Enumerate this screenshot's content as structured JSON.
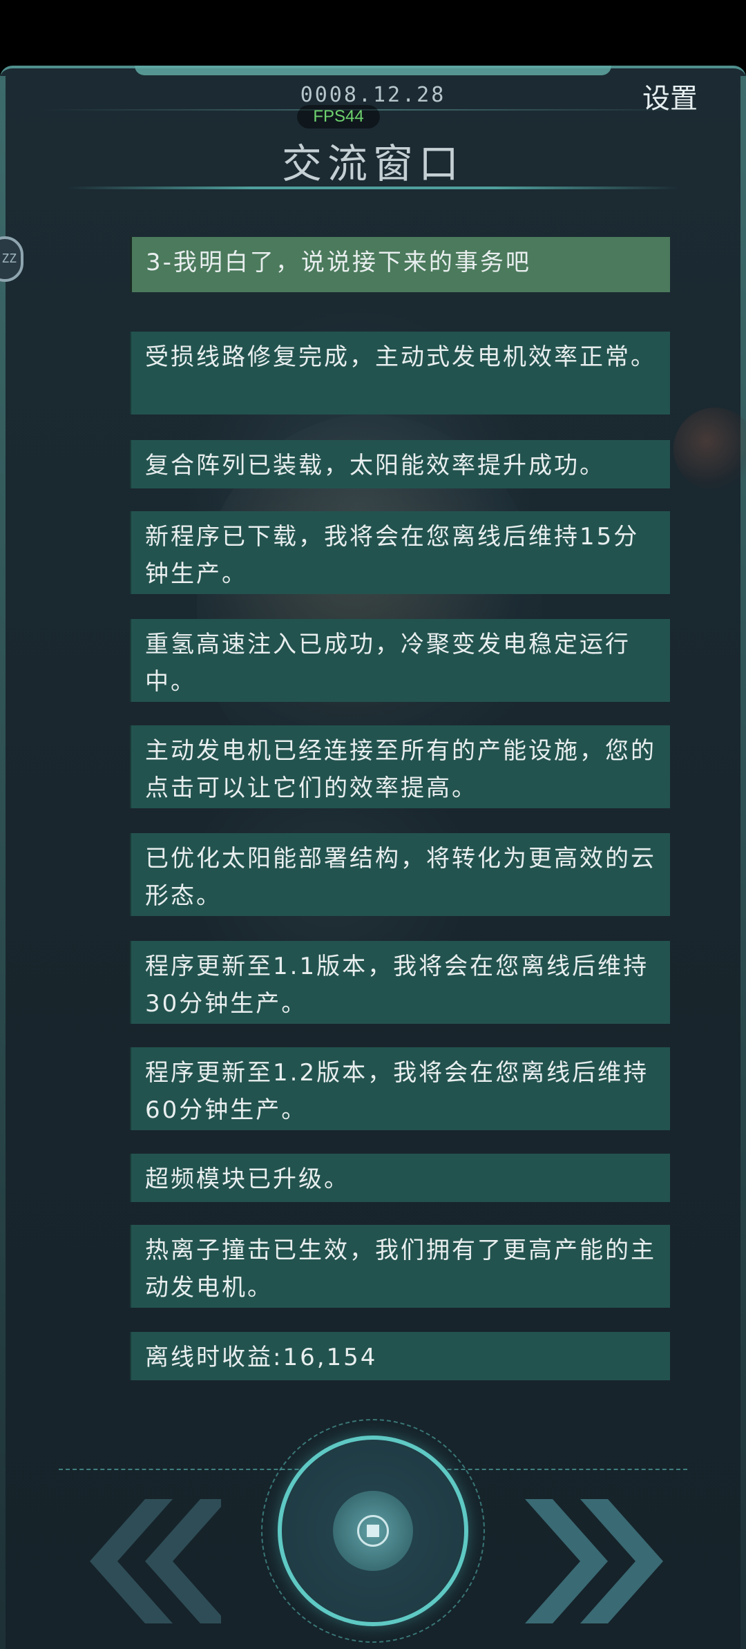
{
  "header": {
    "date": "0008.12.28",
    "fps": "FPS44",
    "settings_label": "设置",
    "title": "交流窗口"
  },
  "sleep_button": {
    "label": "ZZ"
  },
  "choice": {
    "text": "3-我明白了，说说接下来的事务吧"
  },
  "messages": [
    "受损线路修复完成，主动式发电机效率正常。",
    "复合阵列已装载，太阳能效率提升成功。",
    "新程序已下载，我将会在您离线后维持15分钟生产。",
    "重氢高速注入已成功，冷聚变发电稳定运行中。",
    "主动发电机已经连接至所有的产能设施，您的点击可以让它们的效率提高。",
    "已优化太阳能部署结构，将转化为更高效的云形态。",
    "程序更新至1.1版本，我将会在您离线后维持30分钟生产。",
    "程序更新至1.2版本，我将会在您离线后维持60分钟生产。",
    "超频模块已升级。",
    "热离子撞击已生效，我们拥有了更高产能的主动发电机。",
    "离线时收益:16,154"
  ],
  "controls": {
    "prev_icon": "double-chevron-left-icon",
    "next_icon": "double-chevron-right-icon",
    "center_icon": "power-core-icon"
  },
  "colors": {
    "message_bg": "#23534f",
    "choice_bg": "#4b7a5c",
    "accent": "#5fc9c4"
  }
}
